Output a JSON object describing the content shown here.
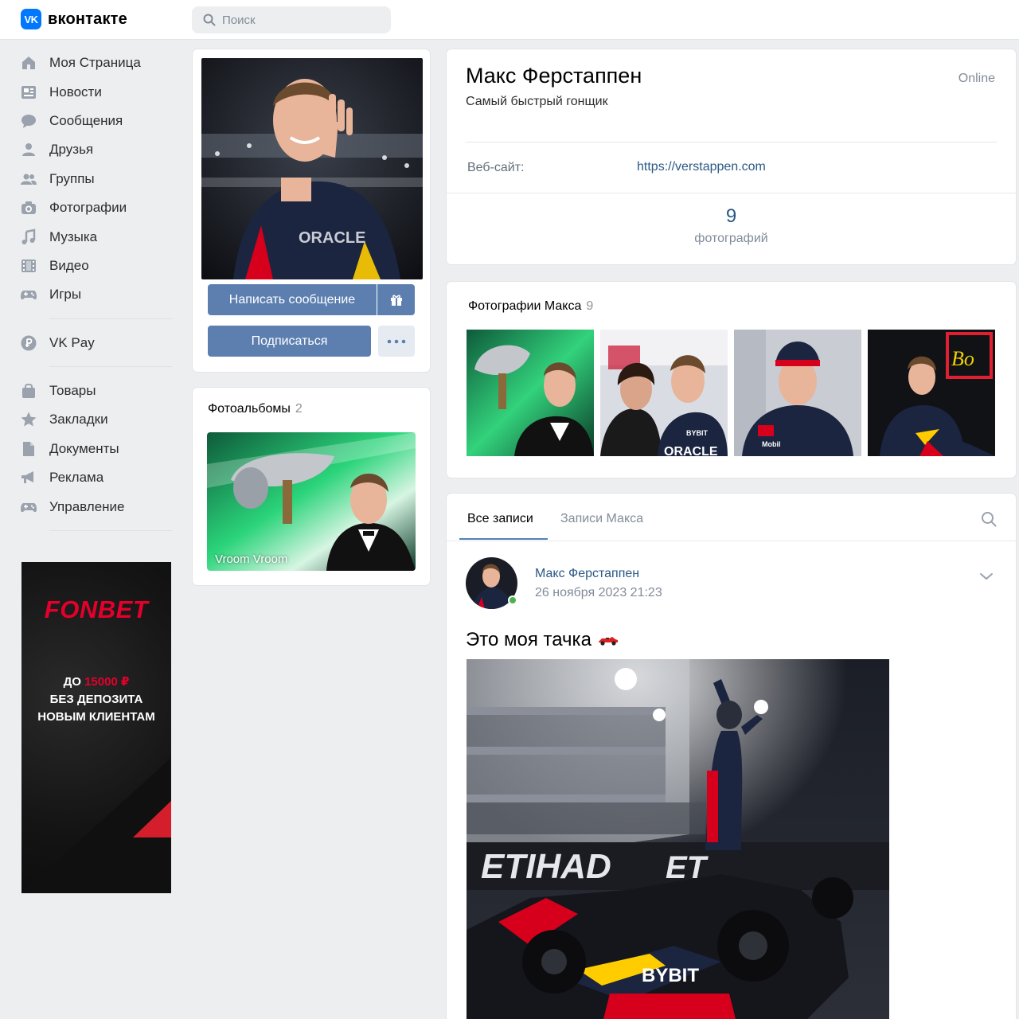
{
  "header": {
    "logo_text": "вконтакте",
    "logo_mark": "VK",
    "search_placeholder": "Поиск"
  },
  "sidebar": {
    "items": [
      {
        "label": "Моя Страница",
        "icon": "home-icon"
      },
      {
        "label": "Новости",
        "icon": "news-icon"
      },
      {
        "label": "Сообщения",
        "icon": "messages-icon"
      },
      {
        "label": "Друзья",
        "icon": "friend-icon"
      },
      {
        "label": "Группы",
        "icon": "groups-icon"
      },
      {
        "label": "Фотографии",
        "icon": "camera-icon"
      },
      {
        "label": "Музыка",
        "icon": "music-icon"
      },
      {
        "label": "Видео",
        "icon": "video-icon"
      },
      {
        "label": "Игры",
        "icon": "gamepad-icon"
      },
      {
        "label": "VK Pay",
        "icon": "vkpay-icon"
      },
      {
        "label": "Товары",
        "icon": "bag-icon"
      },
      {
        "label": "Закладки",
        "icon": "star-icon"
      },
      {
        "label": "Документы",
        "icon": "document-icon"
      },
      {
        "label": "Реклама",
        "icon": "megaphone-icon"
      },
      {
        "label": "Управление",
        "icon": "gamepad-icon"
      }
    ]
  },
  "ad": {
    "brand": "FONBET",
    "line1_prefix": "ДО ",
    "line1_amount": "15000 ₽",
    "line2": "БЕЗ ДЕПОЗИТА",
    "line3": "НОВЫМ КЛИЕНТАМ"
  },
  "profile_actions": {
    "message_button": "Написать сообщение",
    "subscribe_button": "Подписаться"
  },
  "albums": {
    "title": "Фотоальбомы",
    "count": "2",
    "album_name": "Vroom Vroom"
  },
  "profile": {
    "name": "Макс Ферстаппен",
    "status": "Самый быстрый гонщик",
    "online": "Online",
    "website_label": "Веб-сайт:",
    "website_value": "https://verstappen.com",
    "photos_count": "9",
    "photos_label": "фотографий"
  },
  "photos": {
    "title": "Фотографии Макса",
    "count": "9"
  },
  "wall": {
    "tab_all": "Все записи",
    "tab_own": "Записи Макса",
    "post": {
      "author": "Макс Ферстаппен",
      "date": "26 ноября 2023 21:23",
      "text": "Это моя тачка"
    }
  },
  "colors": {
    "accent": "#5c7fb0",
    "link": "#2a5885",
    "background": "#edeef0",
    "vk_blue": "#0077ff",
    "fonbet_red": "#e4002b"
  }
}
